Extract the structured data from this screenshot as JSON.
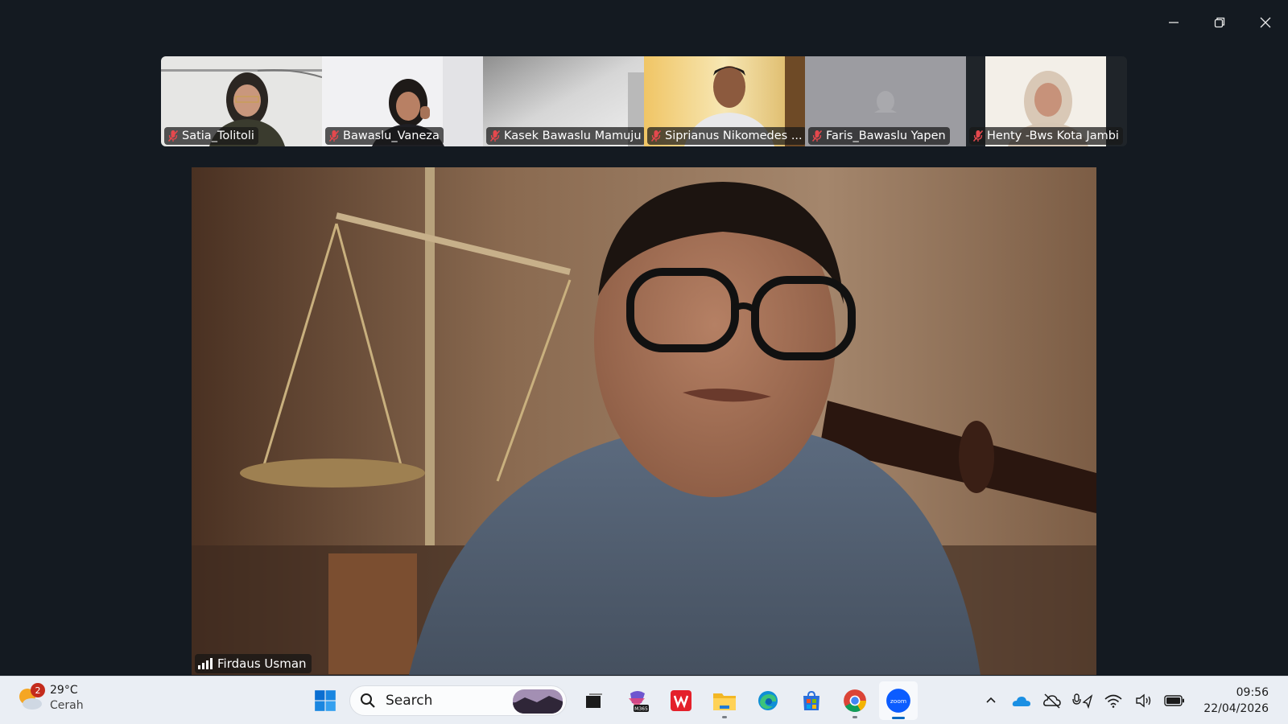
{
  "window": {
    "controls": [
      "minimize",
      "restore",
      "close"
    ]
  },
  "participants": [
    {
      "name": "Satia_Tolitoli",
      "muted": true
    },
    {
      "name": "Bawaslu_Vaneza",
      "muted": true
    },
    {
      "name": "Kasek Bawaslu Mamuju",
      "muted": true
    },
    {
      "name": "Siprianus Nikomedes ...",
      "muted": true
    },
    {
      "name": "Faris_Bawaslu Yapen",
      "muted": true
    },
    {
      "name": "Henty -Bws Kota Jambi",
      "muted": true
    }
  ],
  "speaker": {
    "name": "Firdaus Usman"
  },
  "taskbar": {
    "weather": {
      "badge": "2",
      "temp": "29°C",
      "condition": "Cerah"
    },
    "search_label": "Search",
    "apps": [
      "start-icon",
      "task-view-icon",
      "m365-icon",
      "wps-icon",
      "file-explorer-icon",
      "edge-icon",
      "store-icon",
      "chrome-icon",
      "zoom-icon"
    ],
    "m365_label": "M365",
    "zoom_label": "zoom",
    "clock": {
      "time": "09:56",
      "date": "22/04/2026"
    }
  },
  "colors": {
    "background": "#141a21",
    "muted_mic": "#e5484d",
    "taskbar": "#eaeef4",
    "accent": "#0067c0"
  }
}
